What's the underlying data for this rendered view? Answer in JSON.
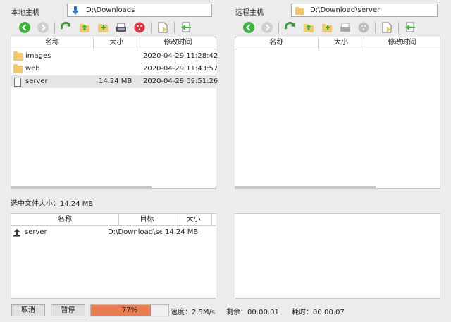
{
  "local": {
    "host_label": "本地主机",
    "path": "D:\\Downloads",
    "columns": [
      "名称",
      "大小",
      "修改时间"
    ],
    "rows": [
      {
        "name": "images",
        "size": "",
        "mtime": "2020-04-29 11:28:42",
        "type": "folder"
      },
      {
        "name": "web",
        "size": "",
        "mtime": "2020-04-29 11:43:57",
        "type": "folder"
      },
      {
        "name": "server",
        "size": "14.24 MB",
        "mtime": "2020-04-29 09:51:26",
        "type": "file"
      }
    ]
  },
  "remote": {
    "host_label": "远程主机",
    "path": "D:\\Download\\server",
    "columns": [
      "名称",
      "大小",
      "修改时间"
    ]
  },
  "selected_size_text": "选中文件大小：14.24 MB",
  "queue": {
    "columns": [
      "名称",
      "目标",
      "大小"
    ],
    "rows": [
      {
        "name": "server",
        "target": "D:\\Download\\server",
        "size": "14.24 MB"
      }
    ]
  },
  "bottom": {
    "cancel_label": "取消",
    "pause_label": "暂停",
    "progress_text": "77%",
    "progress_value": 0.77,
    "speed_text": "速度：2.5M/s",
    "remaining_text": "剩余：00:00:01",
    "elapsed_text": "耗时：00:00:07"
  },
  "colors": {
    "progress_fill": "#e87b4f",
    "nav_green": "#3cb33c",
    "folder_yellow": "#f1c96b",
    "stop_red": "#d9363e"
  }
}
